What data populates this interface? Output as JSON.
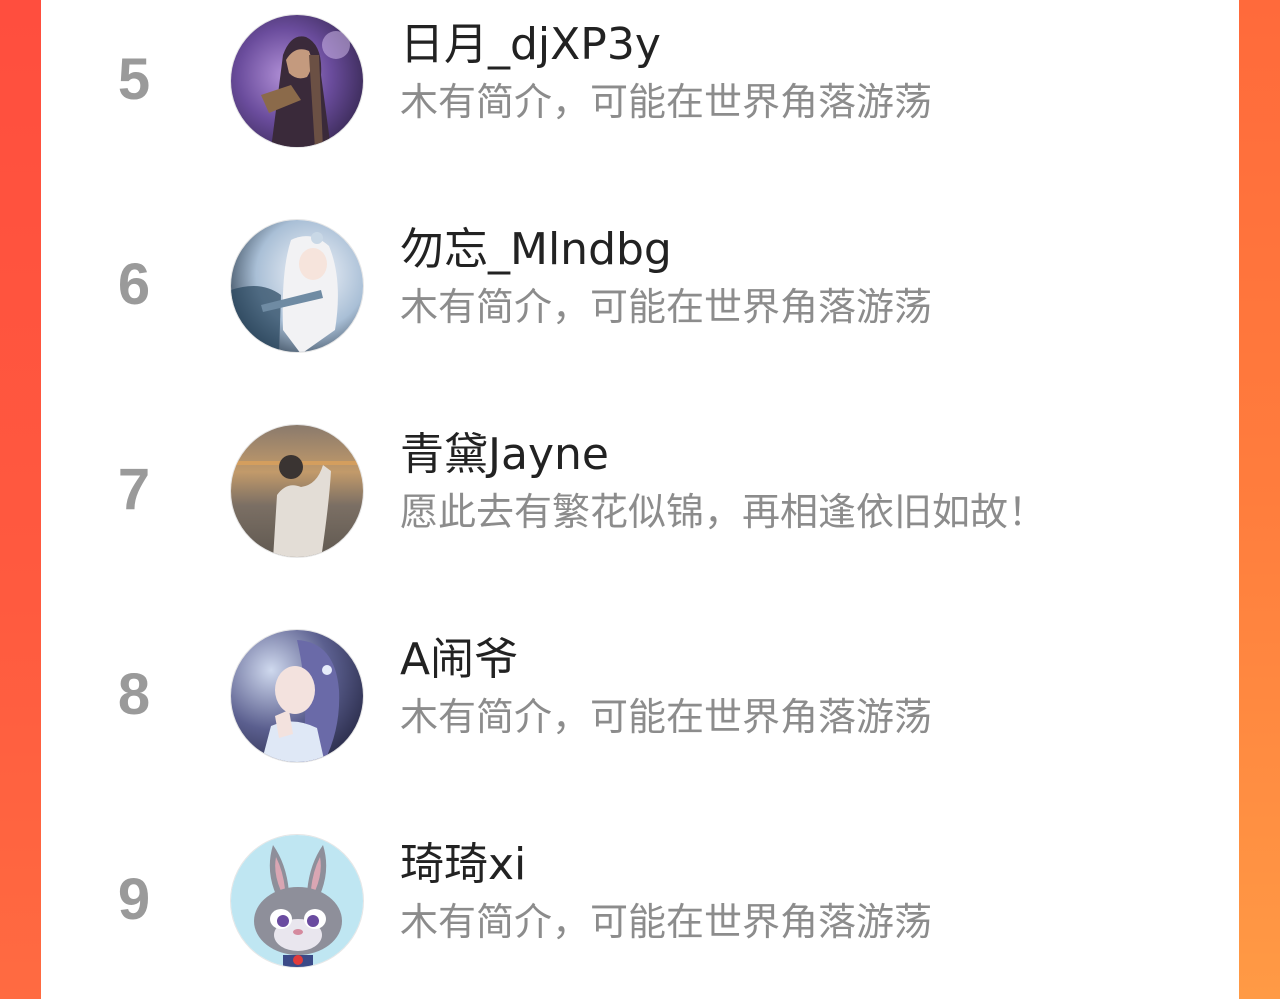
{
  "ranking": {
    "items": [
      {
        "rank": "5",
        "name": "日月_djXP3y",
        "bio": "木有简介，可能在世界角落游荡",
        "avatar_icon": "avatar-illustration-purple"
      },
      {
        "rank": "6",
        "name": "勿忘_Mlndbg",
        "bio": "木有简介，可能在世界角落游荡",
        "avatar_icon": "avatar-illustration-white-hair"
      },
      {
        "rank": "7",
        "name": "青黛Jayne",
        "bio": "愿此去有繁花似锦，再相逢依旧如故！",
        "avatar_icon": "avatar-photo-sunset"
      },
      {
        "rank": "8",
        "name": "A闹爷",
        "bio": "木有简介，可能在世界角落游荡",
        "avatar_icon": "avatar-illustration-girl"
      },
      {
        "rank": "9",
        "name": "琦琦xi",
        "bio": "木有简介，可能在世界角落游荡",
        "avatar_icon": "avatar-bunny-cartoon"
      }
    ]
  },
  "colors": {
    "background_gradient_top": "#ff5a3c",
    "background_gradient_bottom": "#ff8a3e",
    "panel": "#ffffff",
    "rank_text": "#9a9a9a",
    "name_text": "#222222",
    "bio_text": "#8c8c8c"
  }
}
